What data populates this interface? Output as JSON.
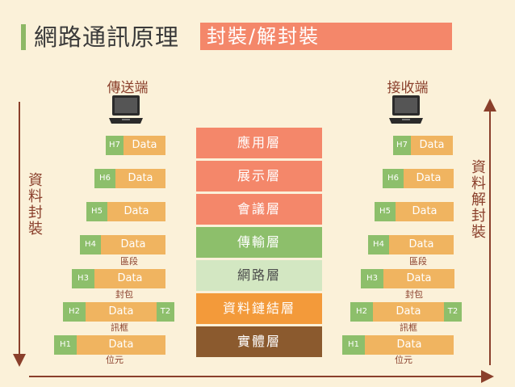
{
  "title": "網路通訊原理",
  "subtitle": "封裝/解封裝",
  "sender": {
    "label": "傳送端",
    "icon": "laptop-icon"
  },
  "receiver": {
    "label": "接收端",
    "icon": "laptop-icon"
  },
  "left_arrow_label": "資料封裝",
  "right_arrow_label": "資料解封裝",
  "layers": [
    {
      "name": "應用層",
      "color": "#f4876a"
    },
    {
      "name": "展示層",
      "color": "#f4876a"
    },
    {
      "name": "會議層",
      "color": "#f4876a"
    },
    {
      "name": "傳輸層",
      "color": "#8dbf6b"
    },
    {
      "name": "網路層",
      "color": "#d3e7c2"
    },
    {
      "name": "資料鏈結層",
      "color": "#f39a3a"
    },
    {
      "name": "實體層",
      "color": "#8b5a2e"
    }
  ],
  "packets": [
    {
      "header": "H7",
      "data": "Data",
      "trailer": "",
      "unit": ""
    },
    {
      "header": "H6",
      "data": "Data",
      "trailer": "",
      "unit": ""
    },
    {
      "header": "H5",
      "data": "Data",
      "trailer": "",
      "unit": ""
    },
    {
      "header": "H4",
      "data": "Data",
      "trailer": "",
      "unit": "區段"
    },
    {
      "header": "H3",
      "data": "Data",
      "trailer": "",
      "unit": "封包"
    },
    {
      "header": "H2",
      "data": "Data",
      "trailer": "T2",
      "unit": "訊框"
    },
    {
      "header": "H1",
      "data": "Data",
      "trailer": "",
      "unit": "位元"
    }
  ],
  "colors": {
    "arrow": "#8a3f2b",
    "title_accent": "#8db865",
    "subtitle_bg": "#f4876a"
  }
}
